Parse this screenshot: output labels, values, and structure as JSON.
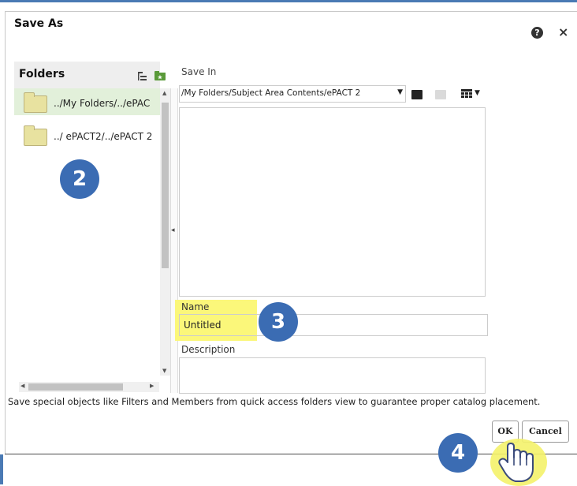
{
  "dialog": {
    "title": "Save As",
    "help_icon": "?",
    "close_icon": "×"
  },
  "folders": {
    "title": "Folders",
    "items": [
      {
        "label": "../My Folders/../ePAC",
        "selected": true
      },
      {
        "label": "../ ePACT2/../ePACT 2",
        "selected": false
      }
    ]
  },
  "save_in": {
    "label": "Save In",
    "path": "/My Folders/Subject Area Contents/ePACT 2"
  },
  "name": {
    "label": "Name",
    "value": "Untitled"
  },
  "description": {
    "label": "Description",
    "value": ""
  },
  "note": "Save special objects like Filters and Members from quick access folders view to guarantee proper catalog placement.",
  "buttons": {
    "ok": "OK",
    "cancel": "Cancel"
  },
  "steps": [
    "2",
    "3",
    "4"
  ],
  "colors": {
    "accent": "#3b6cb3",
    "highlight": "#fbf77a",
    "selected_row": "#e2f0da"
  }
}
